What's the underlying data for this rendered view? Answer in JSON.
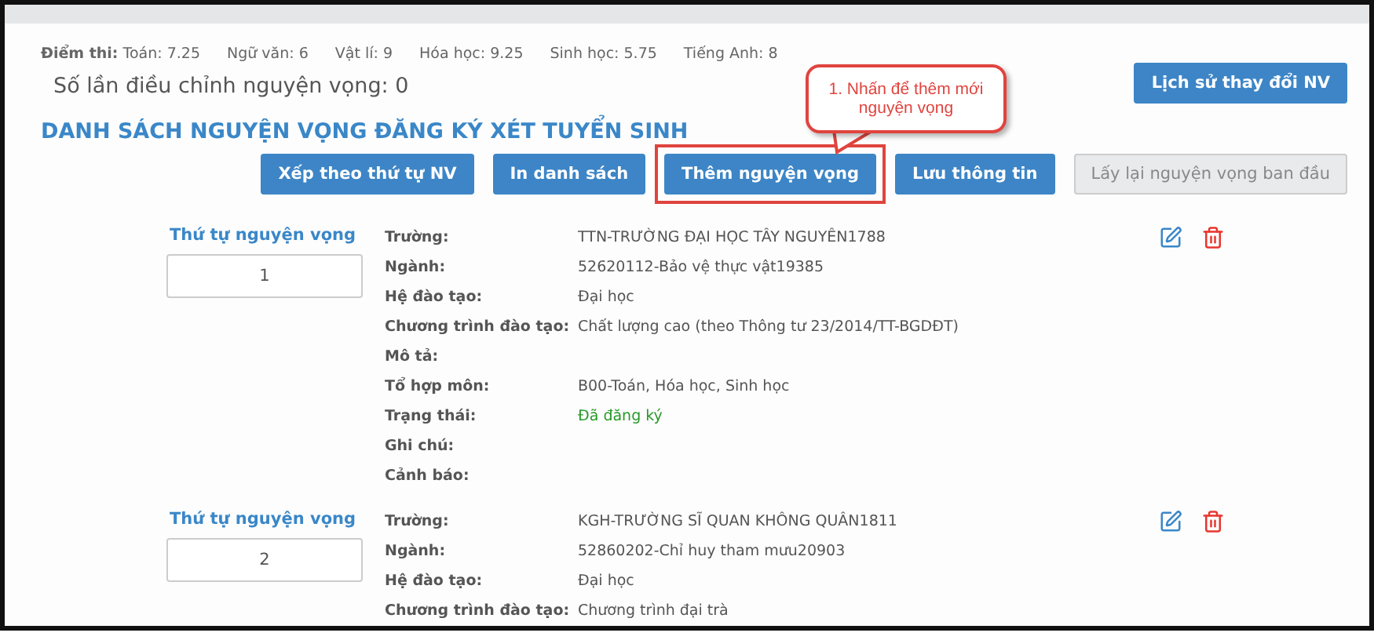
{
  "scores": {
    "label": "Điểm thi:",
    "items": [
      "Toán: 7.25",
      "Ngữ văn: 6",
      "Vật lí: 9",
      "Hóa học: 9.25",
      "Sinh học: 5.75",
      "Tiếng Anh: 8"
    ]
  },
  "adjust_count": "Số lần điều chỉnh nguyện vọng: 0",
  "history_button": "Lịch sử thay đổi NV",
  "title": "DANH SÁCH NGUYỆN VỌNG ĐĂNG KÝ XÉT TUYỂN SINH",
  "buttons": [
    {
      "label": "Xếp theo thứ tự NV",
      "disabled": false,
      "highlighted": false
    },
    {
      "label": "In danh sách",
      "disabled": false,
      "highlighted": false
    },
    {
      "label": "Thêm nguyện vọng",
      "disabled": false,
      "highlighted": true
    },
    {
      "label": "Lưu thông tin",
      "disabled": false,
      "highlighted": false
    },
    {
      "label": "Lấy lại nguyện vọng ban đầu",
      "disabled": true,
      "highlighted": false
    }
  ],
  "callout": "1. Nhấn để thêm mới nguyện vọng",
  "entries": [
    {
      "order_label": "Thứ tự nguyện vọng",
      "order": "1",
      "fields": [
        {
          "label": "Trường:",
          "value": "TTN-TRƯỜNG ĐẠI HỌC TÂY NGUYÊN1788",
          "kind": "text"
        },
        {
          "label": "Ngành:",
          "value": "52620112-Bảo vệ thực vật19385",
          "kind": "text"
        },
        {
          "label": "Hệ đào tạo:",
          "value": "Đại học",
          "kind": "text"
        },
        {
          "label": "Chương trình đào tạo:",
          "value": "Chất lượng cao (theo Thông tư 23/2014/TT-BGDĐT)",
          "kind": "text"
        },
        {
          "label": "Mô tả:",
          "kind": "text"
        },
        {
          "label": "Tổ hợp môn:",
          "value": "B00-Toán, Hóa học, Sinh học",
          "kind": "text"
        },
        {
          "label": "Trạng thái:",
          "value": "Đã đăng ký",
          "kind": "status"
        },
        {
          "label": "Ghi chú:",
          "kind": "text"
        },
        {
          "label": "Cảnh báo:",
          "kind": "text"
        }
      ]
    },
    {
      "order_label": "Thứ tự nguyện vọng",
      "order": "2",
      "fields": [
        {
          "label": "Trường:",
          "value": "KGH-TRƯỜNG SĨ QUAN KHÔNG QUÂN1811",
          "kind": "text"
        },
        {
          "label": "Ngành:",
          "value": "52860202-Chỉ huy tham mưu20903",
          "kind": "text"
        },
        {
          "label": "Hệ đào tạo:",
          "value": "Đại học",
          "kind": "text"
        },
        {
          "label": "Chương trình đào tạo:",
          "value": "Chương trình đại trà",
          "kind": "text"
        }
      ]
    }
  ]
}
